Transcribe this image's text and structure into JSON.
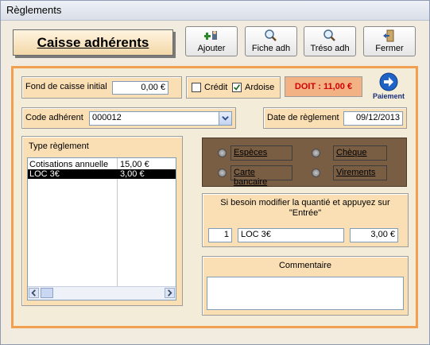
{
  "window": {
    "title": "Règlements"
  },
  "header": {
    "title": "Caisse adhérents"
  },
  "toolbar": {
    "ajouter_label": "Ajouter",
    "fiche_label": "Fiche adh",
    "treso_label": "Tréso adh",
    "fermer_label": "Fermer"
  },
  "fond": {
    "label": "Fond de caisse initial",
    "value": "0,00 €"
  },
  "options": {
    "credit_label": "Crédit",
    "credit_checked": false,
    "ardoise_label": "Ardoise",
    "ardoise_checked": true
  },
  "doit": {
    "label": "DOIT : 11,00 €"
  },
  "paiement": {
    "label": "Paiement"
  },
  "code": {
    "label": "Code adhérent",
    "value": "000012"
  },
  "date": {
    "label": "Date de règlement",
    "value": "09/12/2013"
  },
  "type_reglement": {
    "label": "Type règlement",
    "rows": [
      {
        "name": "Cotisations annuelle",
        "amount": "15,00 €"
      },
      {
        "name": "LOC 3€",
        "amount": "3,00 €"
      }
    ]
  },
  "modes": {
    "especes": "Espèces",
    "cheque": "Chèque",
    "carte": "Carte bancaire",
    "virements": "Virements"
  },
  "quantity": {
    "hint": "Si besoin modifier la quantié et appuyez sur \"Entrée\"",
    "qty": "1",
    "item": "LOC 3€",
    "price": "3,00 €"
  },
  "commentaire": {
    "label": "Commentaire",
    "value": ""
  },
  "colors": {
    "accent": "#f0a050",
    "doit_bg": "#f2b283",
    "doit_text": "#d40000",
    "payment_bg": "#7a5e43"
  }
}
